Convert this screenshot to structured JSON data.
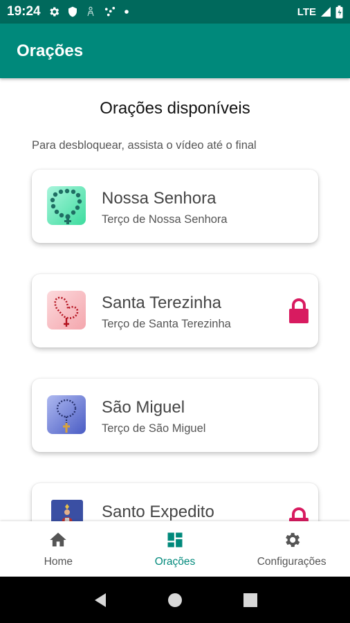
{
  "status_bar": {
    "time": "19:24",
    "network": "LTE",
    "icons": [
      "gear-icon",
      "shield-icon",
      "notification-icon",
      "dots-icon",
      "dot-icon",
      "signal-icon",
      "battery-icon"
    ]
  },
  "app_bar": {
    "title": "Orações"
  },
  "main": {
    "heading": "Orações disponíveis",
    "subtitle": "Para desbloquear, assista o vídeo até o final",
    "prayers": [
      {
        "title": "Nossa Senhora",
        "subtitle": "Terço de Nossa Senhora",
        "locked": false,
        "thumb": "green-rosary-icon"
      },
      {
        "title": "Santa Terezinha",
        "subtitle": "Terço de Santa Terezinha",
        "locked": true,
        "thumb": "red-rosary-icon"
      },
      {
        "title": "São Miguel",
        "subtitle": "Terço de São Miguel",
        "locked": false,
        "thumb": "blue-rosary-icon"
      },
      {
        "title": "Santo Expedito",
        "subtitle": "",
        "locked": true,
        "thumb": "saint-image-icon"
      }
    ]
  },
  "bottom_nav": {
    "items": [
      {
        "label": "Home",
        "icon": "home-icon",
        "active": false
      },
      {
        "label": "Orações",
        "icon": "dashboard-icon",
        "active": true
      },
      {
        "label": "Configurações",
        "icon": "gear-icon",
        "active": false
      }
    ]
  },
  "colors": {
    "status_bar": "#00695c",
    "app_bar": "#00897b",
    "accent": "#00897b",
    "lock": "#d81b60"
  }
}
